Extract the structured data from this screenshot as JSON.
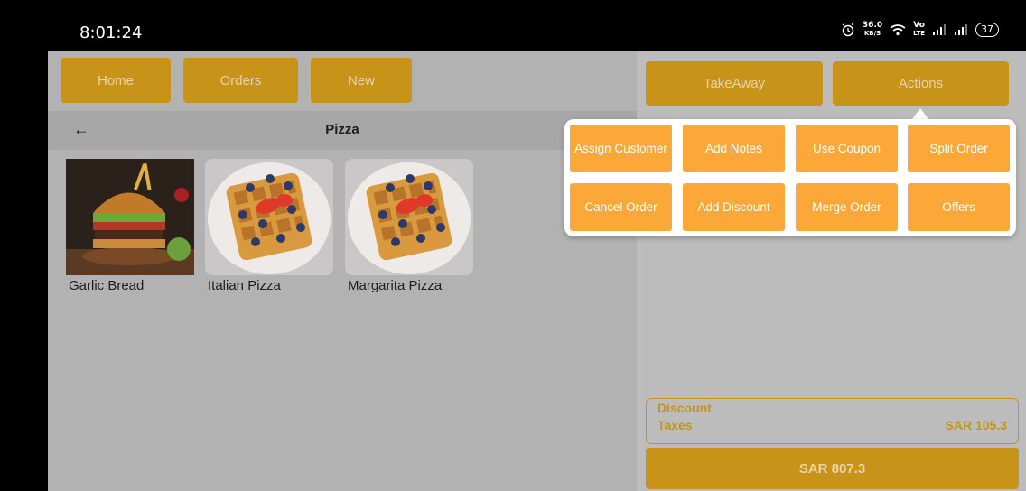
{
  "status_bar": {
    "time": "8:01:24",
    "network_speed_top": "36.0",
    "network_speed_unit": "KB/S",
    "volte_top": "Vo",
    "volte_bottom": "LTE",
    "battery": "37",
    "icons": [
      "alarm-icon",
      "wifi-icon",
      "signal-icon",
      "signal-icon"
    ]
  },
  "nav": {
    "home": "Home",
    "orders": "Orders",
    "new": "New"
  },
  "category": {
    "back_icon": "arrow-left-icon",
    "title": "Pizza"
  },
  "products": [
    {
      "name": "Garlic Bread",
      "image": "burger"
    },
    {
      "name": "Italian Pizza",
      "image": "waffle"
    },
    {
      "name": "Margarita Pizza",
      "image": "waffle"
    }
  ],
  "order": {
    "takeaway_label": "TakeAway",
    "actions_label": "Actions",
    "discount_label": "Discount",
    "taxes_label": "Taxes",
    "taxes_value": "SAR 105.3",
    "total_label": "SAR 807.3"
  },
  "actions_menu": {
    "items": [
      "Assign Customer",
      "Add Notes",
      "Use Coupon",
      "Split Order",
      "Cancel Order",
      "Add Discount",
      "Merge Order",
      "Offers"
    ]
  },
  "colors": {
    "accent": "#c89319",
    "action_orange": "#fca838",
    "overlay_gray": "#b2b2b2"
  }
}
